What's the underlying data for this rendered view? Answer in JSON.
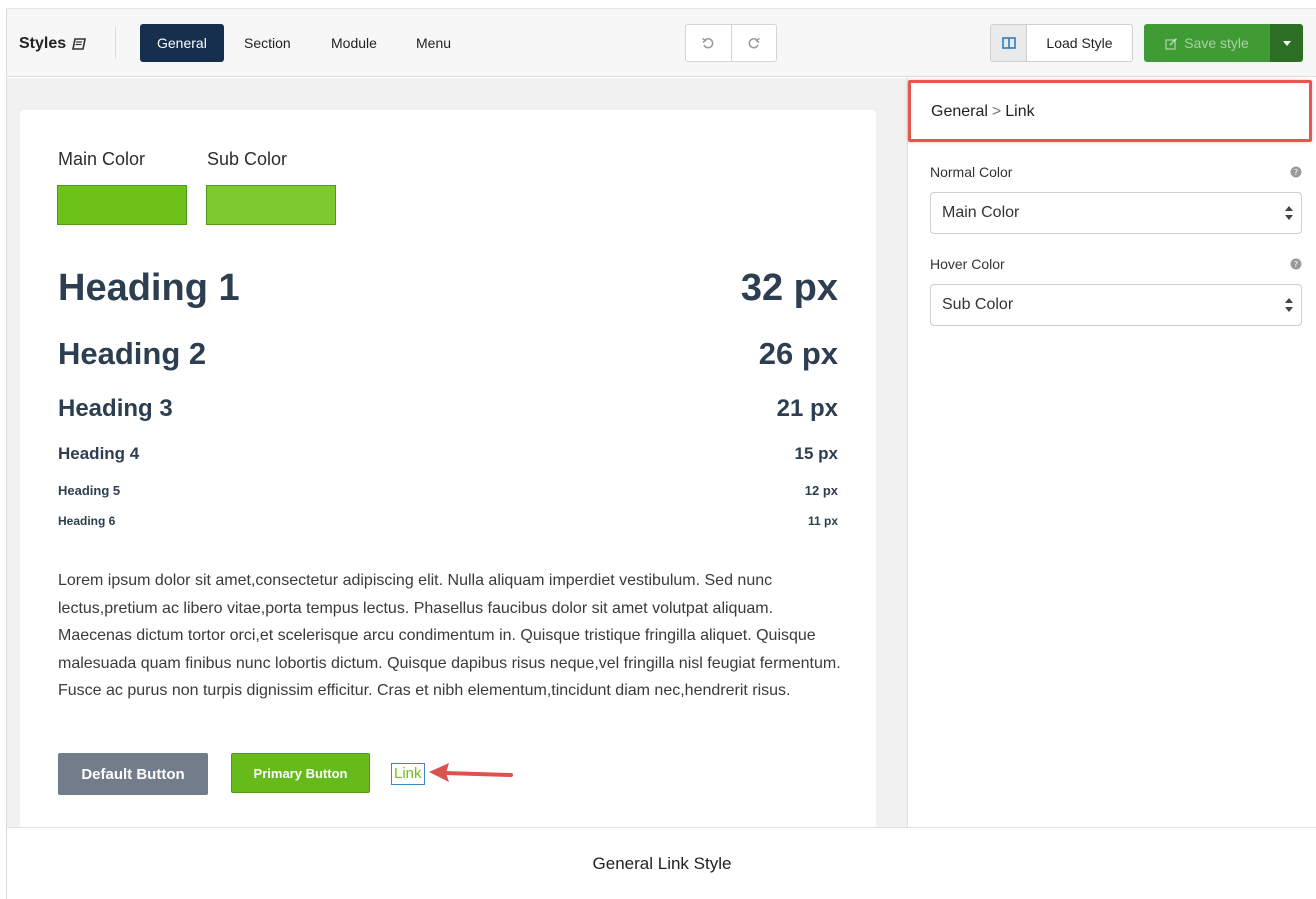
{
  "toolbar": {
    "title": "Styles",
    "tabs": [
      "General",
      "Section",
      "Module",
      "Menu"
    ],
    "active_tab": "General",
    "load_style_label": "Load Style",
    "save_style_label": "Save style"
  },
  "preview": {
    "main_color_label": "Main Color",
    "sub_color_label": "Sub Color",
    "colors": {
      "main": "#6cc218",
      "sub": "#7cca30",
      "heading": "#2c3e50",
      "active_tab_bg": "#152f4d"
    },
    "headings": [
      {
        "label": "Heading 1",
        "size": "32 px"
      },
      {
        "label": "Heading 2",
        "size": "26 px"
      },
      {
        "label": "Heading 3",
        "size": "21 px"
      },
      {
        "label": "Heading 4",
        "size": "15 px"
      },
      {
        "label": "Heading 5",
        "size": "12 px"
      },
      {
        "label": "Heading 6",
        "size": "11 px"
      }
    ],
    "body_text": "Lorem ipsum dolor sit amet,consectetur adipiscing elit. Nulla aliquam imperdiet vestibulum. Sed nunc lectus,pretium ac libero vitae,porta tempus lectus. Phasellus faucibus dolor sit amet volutpat aliquam. Maecenas dictum tortor orci,et scelerisque arcu condimentum in. Quisque tristique fringilla aliquet. Quisque malesuada quam finibus nunc lobortis dictum. Quisque dapibus risus neque,vel fringilla nisl feugiat fermentum. Fusce ac purus non turpis dignissim efficitur. Cras et nibh elementum,tincidunt diam nec,hendrerit risus.",
    "default_button": "Default Button",
    "primary_button": "Primary Button",
    "link_text": "Link"
  },
  "panel": {
    "breadcrumb_root": "General",
    "breadcrumb_sep": ">",
    "breadcrumb_leaf": "Link",
    "normal_color_label": "Normal Color",
    "normal_color_value": "Main Color",
    "hover_color_label": "Hover Color",
    "hover_color_value": "Sub Color"
  },
  "caption": "General Link Style"
}
